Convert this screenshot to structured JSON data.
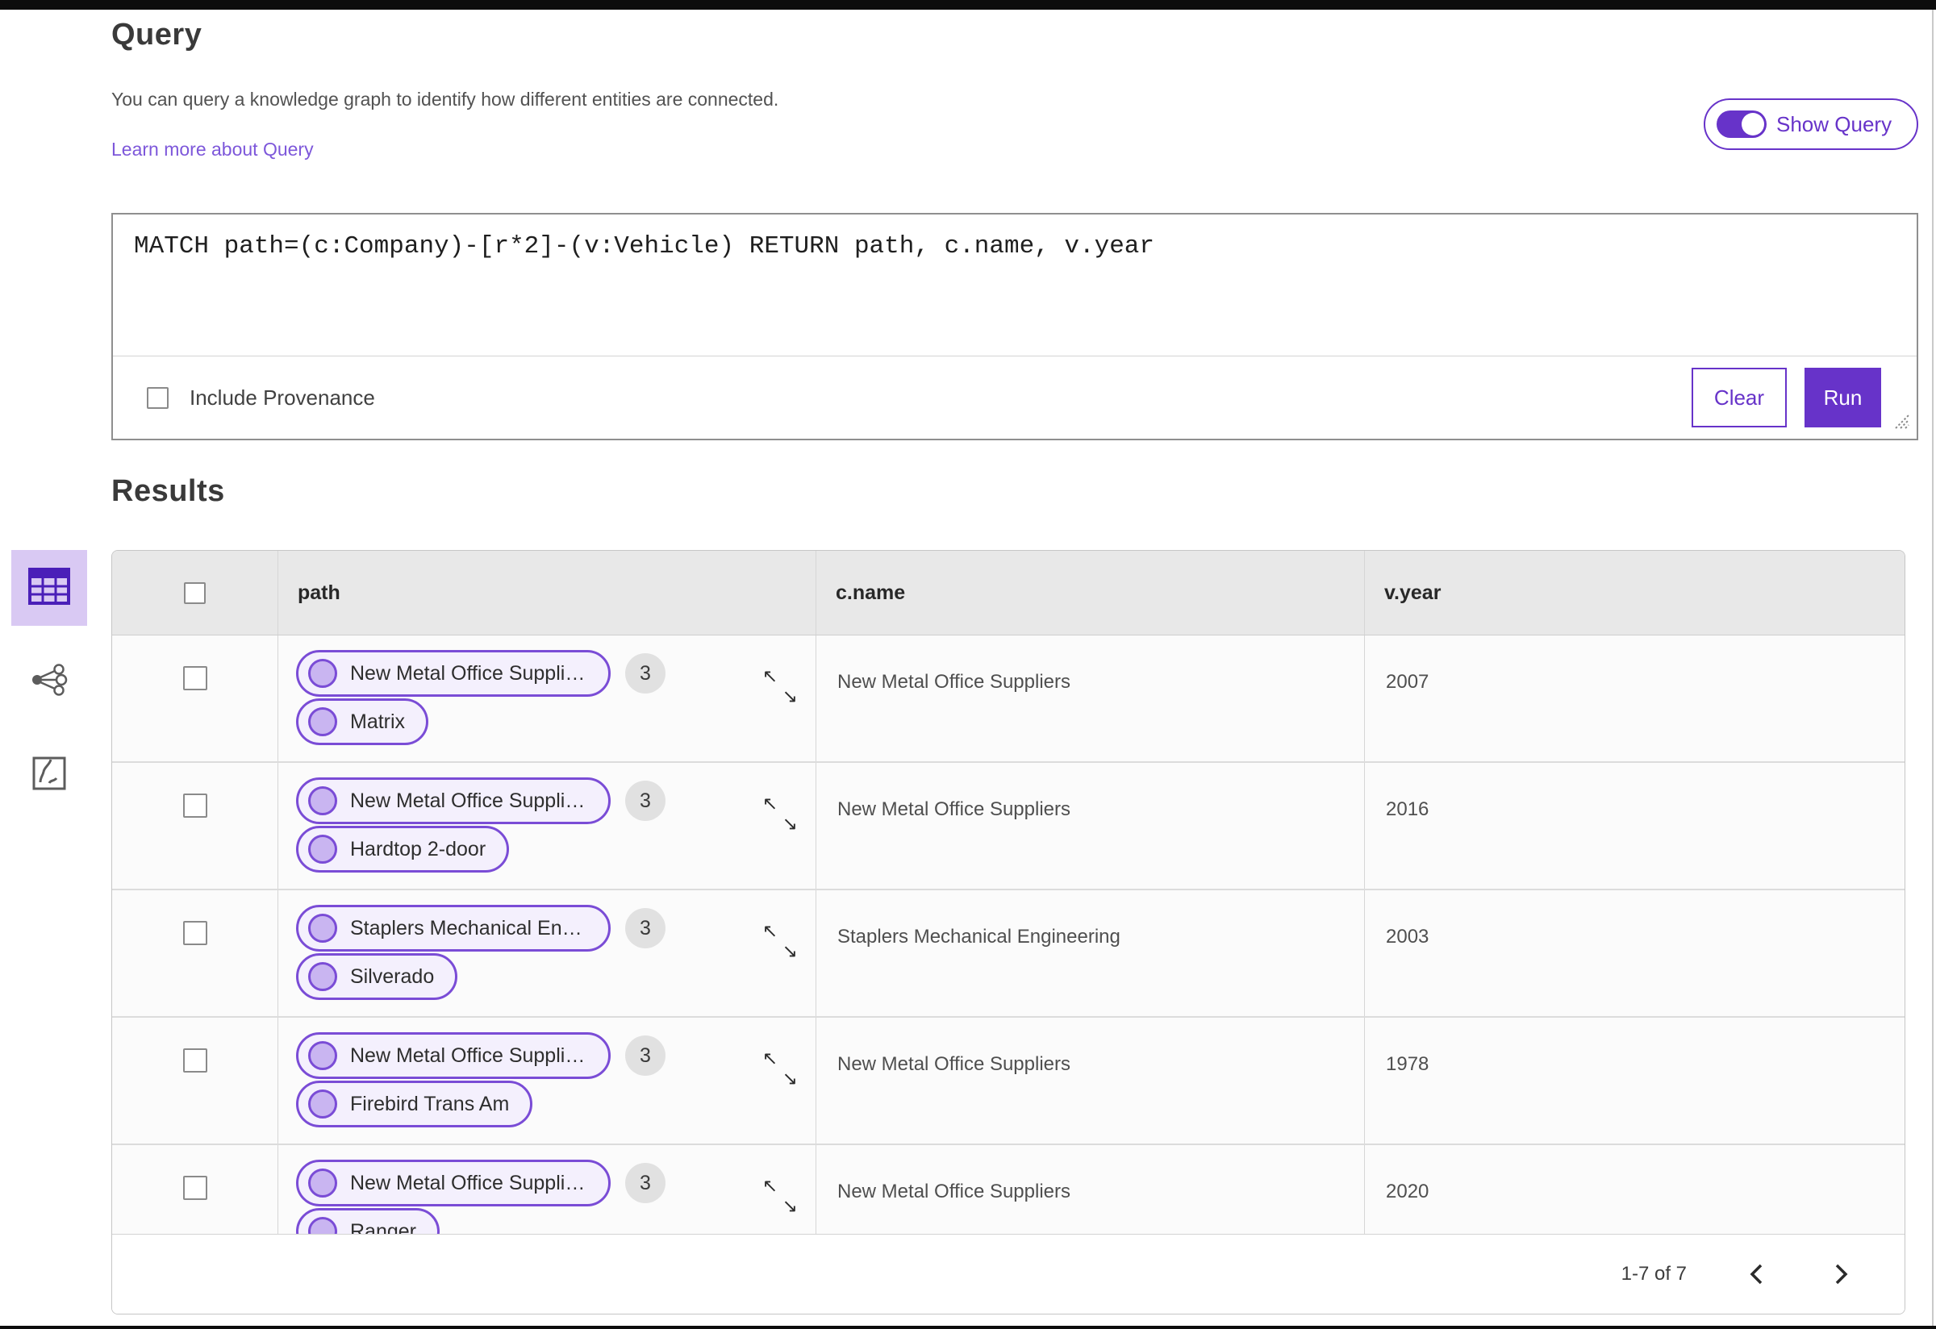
{
  "page": {
    "title": "Query",
    "description": "You can query a knowledge graph to identify how different entities are connected.",
    "learn_more": "Learn more about Query",
    "show_query_label": "Show Query",
    "show_query_on": true
  },
  "query_panel": {
    "query_text": "MATCH path=(c:Company)-[r*2]-(v:Vehicle) RETURN path, c.name, v.year",
    "include_provenance_label": "Include Provenance",
    "include_provenance_checked": false,
    "clear_label": "Clear",
    "run_label": "Run"
  },
  "results": {
    "title": "Results",
    "views": [
      {
        "name": "table-view",
        "selected": true
      },
      {
        "name": "graph-view",
        "selected": false
      },
      {
        "name": "map-view",
        "selected": false
      }
    ],
    "table": {
      "columns": [
        "path",
        "c.name",
        "v.year"
      ],
      "rows": [
        {
          "path_pills": [
            "New Metal Office Suppliers",
            "Matrix"
          ],
          "count": "3",
          "c_name": "New Metal Office Suppliers",
          "v_year": "2007"
        },
        {
          "path_pills": [
            "New Metal Office Suppliers",
            "Hardtop 2-door"
          ],
          "count": "3",
          "c_name": "New Metal Office Suppliers",
          "v_year": "2016"
        },
        {
          "path_pills": [
            "Staplers Mechanical Engi...",
            "Silverado"
          ],
          "count": "3",
          "c_name": "Staplers Mechanical Engineering",
          "v_year": "2003"
        },
        {
          "path_pills": [
            "New Metal Office Suppliers",
            "Firebird Trans Am"
          ],
          "count": "3",
          "c_name": "New Metal Office Suppliers",
          "v_year": "1978"
        },
        {
          "path_pills": [
            "New Metal Office Suppliers",
            "Ranger"
          ],
          "count": "3",
          "c_name": "New Metal Office Suppliers",
          "v_year": "2020"
        }
      ]
    },
    "pagination": {
      "range_label": "1-7 of 7"
    }
  },
  "icons": {
    "expand_nw": "↖",
    "expand_se": "↘"
  },
  "colors": {
    "accent": "#6733c9",
    "link": "#7d57da",
    "pill_border": "#7a4cd6",
    "pill_bg": "#f4f0fd",
    "pill_dot": "#c9b5f1",
    "selected_tile_bg": "#d9c9f3",
    "header_bg": "#e8e8e8",
    "badge_bg": "#e1e1e1"
  }
}
